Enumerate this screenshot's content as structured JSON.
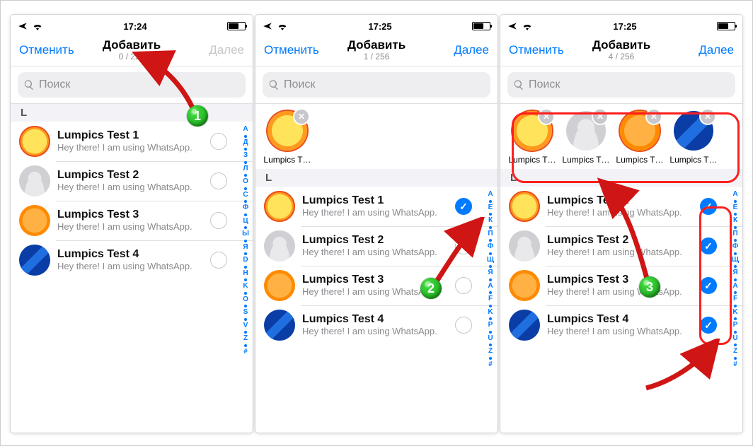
{
  "statusbar": {
    "time1": "17:24",
    "time2": "17:25",
    "time3": "17:25"
  },
  "nav": {
    "cancel": "Отменить",
    "title": "Добавить",
    "count1": "0 / 256",
    "count2": "1 / 256",
    "count3": "4 / 256",
    "next": "Далее"
  },
  "search": {
    "placeholder": "Поиск"
  },
  "section": {
    "letter": "L"
  },
  "contacts": [
    {
      "name": "Lumpics Test 1",
      "status": "Hey there! I am using WhatsApp.",
      "avatar": "lemon"
    },
    {
      "name": "Lumpics Test 2",
      "status": "Hey there! I am using WhatsApp.",
      "avatar": "silhouette"
    },
    {
      "name": "Lumpics Test 3",
      "status": "Hey there! I am using WhatsApp.",
      "avatar": "orange"
    },
    {
      "name": "Lumpics Test 4",
      "status": "Hey there! I am using WhatsApp.",
      "avatar": "blue"
    }
  ],
  "chip_label": "Lumpics T…",
  "index1": [
    "А",
    "●",
    "Д",
    "●",
    "З",
    "●",
    "Л",
    "●",
    "О",
    "●",
    "С",
    "●",
    "Ф",
    "●",
    "Ц",
    "●",
    "Ы",
    "●",
    "Я",
    "●",
    "D",
    "●",
    "H",
    "●",
    "K",
    "●",
    "O",
    "●",
    "S",
    "●",
    "V",
    "●",
    "Z",
    "●",
    "#"
  ],
  "index2": [
    "А",
    "●",
    "Е",
    "●",
    "К",
    "●",
    "П",
    "●",
    "Ф",
    "●",
    "Щ",
    "●",
    "Я",
    "●",
    "A",
    "●",
    "F",
    "●",
    "K",
    "●",
    "P",
    "●",
    "U",
    "●",
    "Z",
    "●",
    "#"
  ],
  "badges": {
    "b1": "1",
    "b2": "2",
    "b3": "3"
  }
}
